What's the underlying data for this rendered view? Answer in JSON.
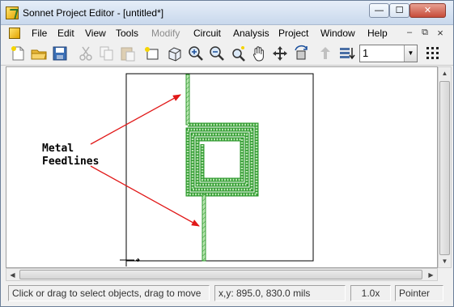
{
  "window": {
    "title": "Sonnet Project Editor - [untitled*]",
    "controls": {
      "minimize": "—",
      "maximize": "☐",
      "close": "✕"
    }
  },
  "menu": {
    "items": [
      {
        "label": "File",
        "enabled": true
      },
      {
        "label": "Edit",
        "enabled": true
      },
      {
        "label": "View",
        "enabled": true
      },
      {
        "label": "Tools",
        "enabled": true
      },
      {
        "label": "Modify",
        "enabled": false
      },
      {
        "label": "Circuit",
        "enabled": true
      },
      {
        "label": "Analysis",
        "enabled": true
      },
      {
        "label": "Project",
        "enabled": true
      },
      {
        "label": "Window",
        "enabled": true
      },
      {
        "label": "Help",
        "enabled": true
      }
    ],
    "mdi_controls": {
      "minimize": "–",
      "restore": "⧉",
      "close": "×"
    }
  },
  "toolbar": {
    "buttons": [
      {
        "icon": "new-file-icon",
        "enabled": true
      },
      {
        "icon": "open-folder-icon",
        "enabled": true
      },
      {
        "icon": "save-icon",
        "enabled": true
      },
      {
        "icon": "cut-icon",
        "enabled": false
      },
      {
        "icon": "copy-icon",
        "enabled": false
      },
      {
        "icon": "paste-icon",
        "enabled": false
      },
      {
        "icon": "add-polygon-icon",
        "enabled": true
      },
      {
        "icon": "3d-view-icon",
        "enabled": true
      },
      {
        "icon": "zoom-in-icon",
        "enabled": true
      },
      {
        "icon": "zoom-out-icon",
        "enabled": true
      },
      {
        "icon": "zoom-fit-icon",
        "enabled": true
      },
      {
        "icon": "pan-hand-icon",
        "enabled": true
      },
      {
        "icon": "move-icon",
        "enabled": true
      },
      {
        "icon": "rotate-icon",
        "enabled": true
      },
      {
        "icon": "level-up-icon",
        "enabled": false
      },
      {
        "icon": "level-down-icon",
        "enabled": true
      }
    ],
    "level_select": {
      "value": "1"
    },
    "grid_icon": "grid-dots-icon"
  },
  "canvas": {
    "annotation": {
      "line1": "Metal",
      "line2": "Feedlines"
    },
    "colors": {
      "metal_fill": "#b9e6b1",
      "metal_edge": "#2f9a2f",
      "arrow": "#e11919",
      "box": "#000000"
    }
  },
  "status": {
    "message": "Click or drag to select objects, drag to move",
    "coords": "x,y: 895.0, 830.0 mils",
    "zoom": "1.0x",
    "mode": "Pointer"
  }
}
